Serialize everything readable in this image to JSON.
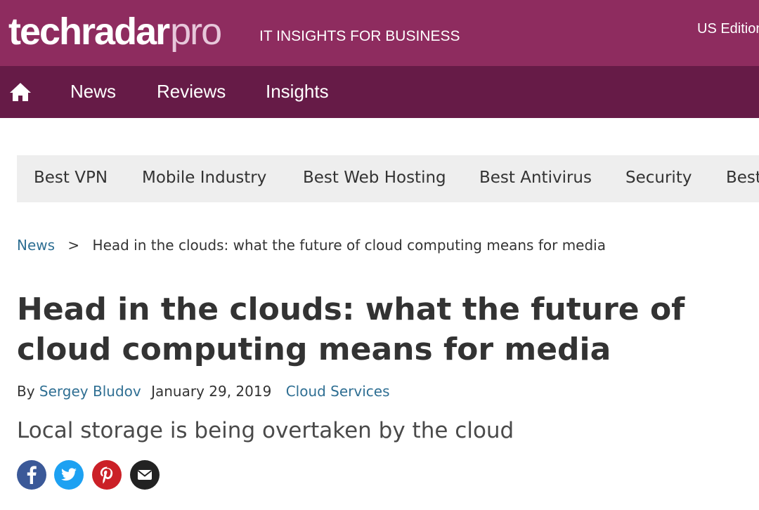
{
  "header": {
    "logo_main": "techradar",
    "logo_pro": "pro",
    "tagline": "IT INSIGHTS FOR BUSINESS",
    "edition": "US Edition",
    "brand_color": "#8e2c5f"
  },
  "nav": {
    "home_icon": "home-icon",
    "items": [
      "News",
      "Reviews",
      "Insights"
    ],
    "color": "#661b47"
  },
  "subnav": {
    "items": [
      "Best VPN",
      "Mobile Industry",
      "Best Web Hosting",
      "Best Antivirus",
      "Security",
      "Best"
    ]
  },
  "breadcrumb": {
    "parent": "News",
    "separator": ">",
    "current": "Head in the clouds: what the future of cloud computing means for media"
  },
  "article": {
    "title": "Head in the clouds: what the future of cloud computing means for media",
    "by": "By",
    "author": "Sergey Bludov",
    "date": "January 29, 2019",
    "category": "Cloud Services",
    "subtitle": "Local storage is being overtaken by the cloud"
  },
  "share": {
    "icons": [
      "facebook-icon",
      "twitter-icon",
      "pinterest-icon",
      "email-icon"
    ],
    "colors": {
      "facebook": "#3b5998",
      "twitter": "#1da1f2",
      "pinterest": "#cb2027",
      "email": "#222222"
    }
  }
}
